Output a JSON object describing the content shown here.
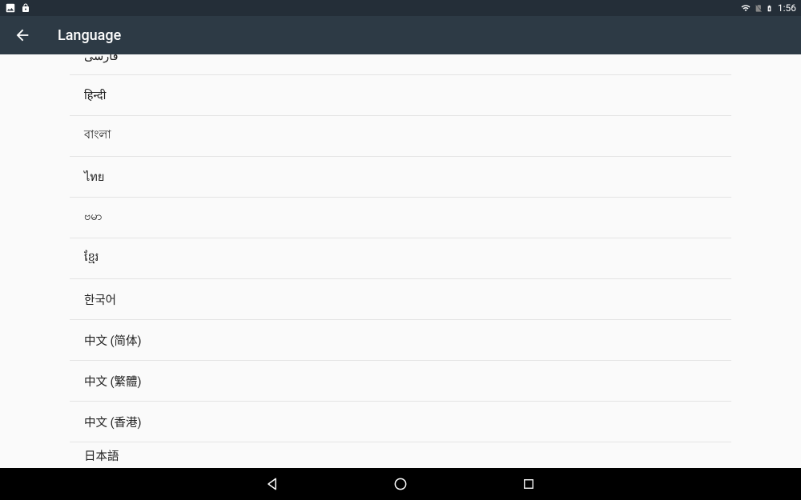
{
  "status_bar": {
    "time": "1:56"
  },
  "app_bar": {
    "title": "Language"
  },
  "languages": [
    "فارسی",
    "हिन्दी",
    "বাংলা",
    "ไทย",
    "ဗမာ",
    "ខ្មែរ",
    "한국어",
    "中文 (简体)",
    "中文 (繁體)",
    "中文 (香港)",
    "日本語"
  ]
}
